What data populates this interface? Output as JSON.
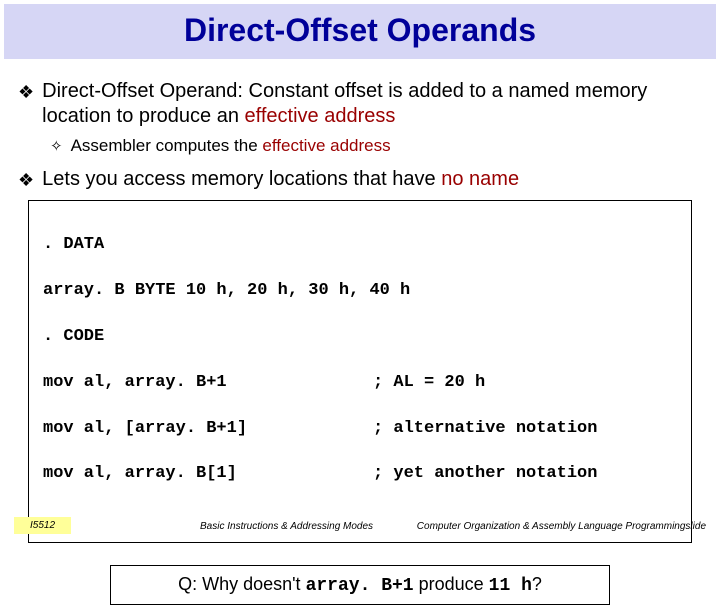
{
  "title": "Direct-Offset Operands",
  "bullets": {
    "b1_pre": "Direct-Offset Operand: Constant offset is added to a named memory location to produce an ",
    "b1_red": "effective address",
    "b1_sub_pre": "Assembler computes the ",
    "b1_sub_red": "effective address",
    "b2_pre": "Lets you access memory locations that have ",
    "b2_red": "no name"
  },
  "code": {
    "l1": ". DATA",
    "l2": "array. B BYTE 10 h, 20 h, 30 h, 40 h",
    "l3": ". CODE",
    "l4a": "mov al, array. B+1",
    "l4b": "; AL = 20 h",
    "l5a": "mov al, [array. B+1]",
    "l5b": "; alternative notation",
    "l6a": "mov al, array. B[1]",
    "l6b": "; yet another notation"
  },
  "question": {
    "pre": "Q: Why doesn't ",
    "mid": "array. B+1",
    "post": " produce ",
    "end": "11 h",
    "q": "?"
  },
  "footer": {
    "left": "I5512",
    "center": "Basic Instructions & Addressing Modes",
    "right": "Computer Organization & Assembly Language Programmingslide"
  }
}
